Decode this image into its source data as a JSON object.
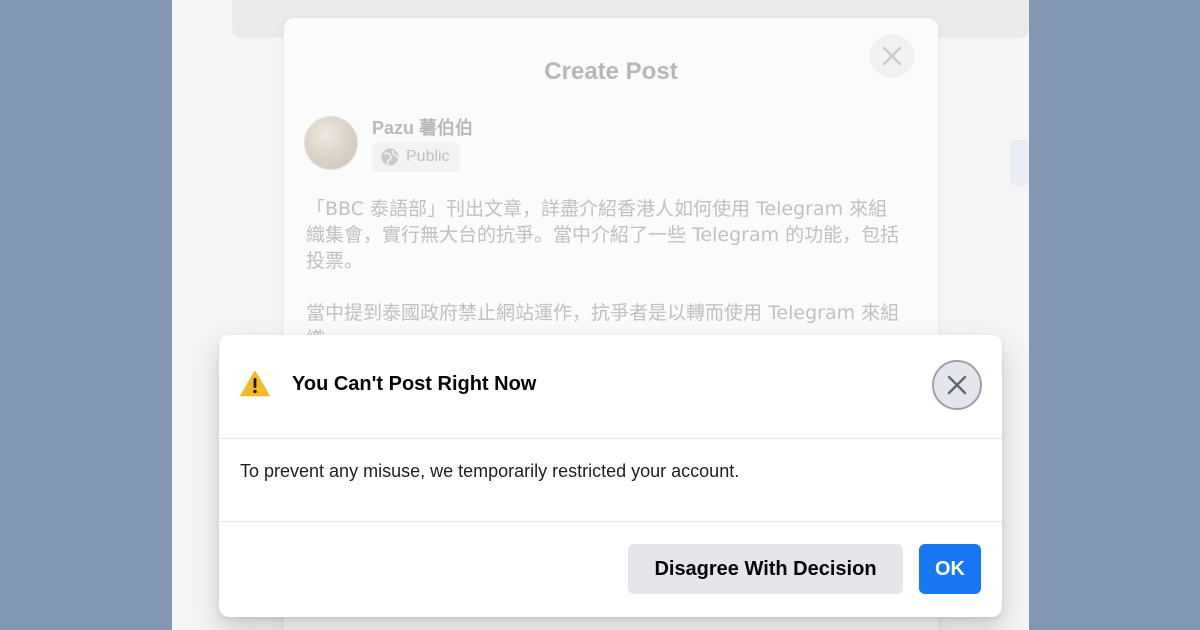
{
  "composer": {
    "title": "Create Post",
    "user_name": "Pazu 薯伯伯",
    "privacy": "Public",
    "body_paragraphs": [
      "「BBC 泰語部」刊出文章，詳盡介紹香港人如何使用 Telegram 來組織集會，實行無大台的抗爭。當中介紹了一些 Telegram 的功能，包括投票。",
      "當中提到泰國政府禁止網站運作，抗爭者是以轉而使用 Telegram 來組織…"
    ],
    "icons": {
      "close": "close-icon",
      "privacy": "globe-icon"
    }
  },
  "dialog": {
    "title": "You Can't Post Right Now",
    "message": "To prevent any misuse, we temporarily restricted your account.",
    "disagree_label": "Disagree With Decision",
    "ok_label": "OK",
    "icons": {
      "warning": "warning-icon",
      "close": "close-icon"
    }
  },
  "colors": {
    "backdrop": "#8497b2",
    "accent": "#1877f2",
    "warning": "#f7b928"
  }
}
